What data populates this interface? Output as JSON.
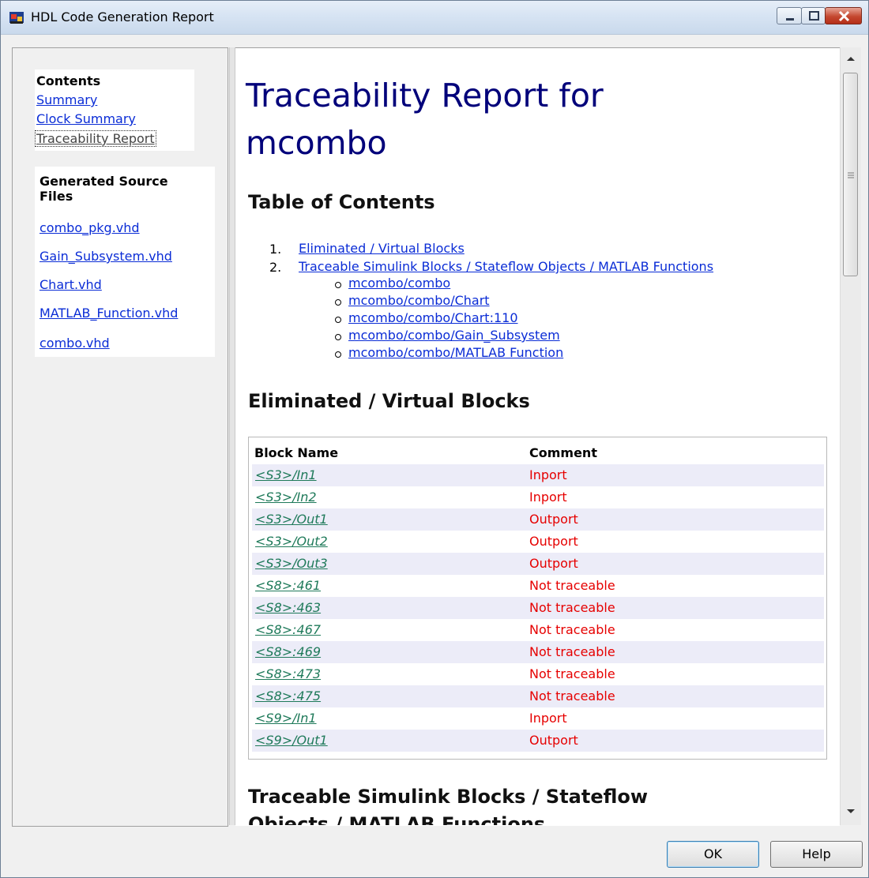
{
  "window": {
    "title": "HDL Code Generation Report",
    "icon": "simulink-app-icon"
  },
  "sidebar": {
    "contents_title": "Contents",
    "contents_links": [
      "Summary",
      "Clock Summary",
      "Traceability Report"
    ],
    "files_title_line1": "Generated Source",
    "files_title_line2": "Files",
    "files": [
      "combo_pkg.vhd",
      "Gain_Subsystem.vhd",
      "Chart.vhd",
      "MATLAB_Function.vhd",
      "combo.vhd"
    ]
  },
  "report": {
    "title_line1": "Traceability Report for",
    "title_line2": "mcombo",
    "toc_heading": "Table of Contents",
    "toc_items": [
      {
        "num": "1.",
        "label": "Eliminated / Virtual Blocks"
      },
      {
        "num": "2.",
        "label": "Traceable Simulink Blocks / Stateflow Objects / MATLAB Functions"
      }
    ],
    "toc_subitems": [
      "mcombo/combo",
      "mcombo/combo/Chart",
      "mcombo/combo/Chart:110",
      "mcombo/combo/Gain_Subsystem",
      "mcombo/combo/MATLAB Function"
    ],
    "eliminated_heading": "Eliminated / Virtual Blocks",
    "table": {
      "headers": [
        "Block Name",
        "Comment"
      ],
      "rows": [
        {
          "block": "<S3>/In1",
          "comment": "Inport"
        },
        {
          "block": "<S3>/In2",
          "comment": "Inport"
        },
        {
          "block": "<S3>/Out1",
          "comment": "Outport"
        },
        {
          "block": "<S3>/Out2",
          "comment": "Outport"
        },
        {
          "block": "<S3>/Out3",
          "comment": "Outport"
        },
        {
          "block": "<S8>:461",
          "comment": "Not traceable"
        },
        {
          "block": "<S8>:463",
          "comment": "Not traceable"
        },
        {
          "block": "<S8>:467",
          "comment": "Not traceable"
        },
        {
          "block": "<S8>:469",
          "comment": "Not traceable"
        },
        {
          "block": "<S8>:473",
          "comment": "Not traceable"
        },
        {
          "block": "<S8>:475",
          "comment": "Not traceable"
        },
        {
          "block": "<S9>/In1",
          "comment": "Inport"
        },
        {
          "block": "<S9>/Out1",
          "comment": "Outport"
        }
      ]
    },
    "traceable_heading_line1": "Traceable Simulink Blocks / Stateflow",
    "traceable_heading_line2": "Objects / MATLAB Functions"
  },
  "buttons": {
    "ok": "OK",
    "help": "Help"
  },
  "colors": {
    "link": "#0a2cd6",
    "title": "#00007a",
    "block_link": "#1f7a5a",
    "comment": "#e60000",
    "alt_row": "#ececf8"
  }
}
